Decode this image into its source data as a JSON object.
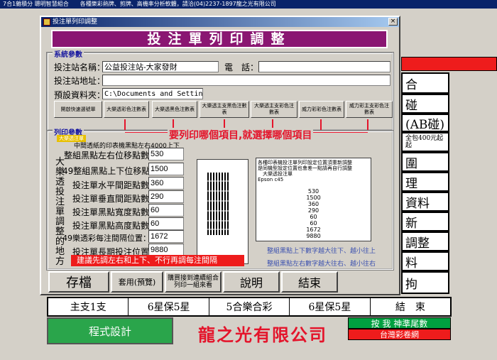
{
  "app": {
    "title": "7合1雜積分 聰明智慧組合　　各種樂彩熱牌、剪牌、高機率分析軟體，請洽(04)2237-1897龍之光有限公司"
  },
  "background": {
    "right_buttons": [
      "合",
      "碰",
      "(AB碰)",
      "全包400元起\n起",
      "圍",
      "理",
      "資料",
      "新",
      "調整",
      "料",
      "拘"
    ],
    "bottom_bar": [
      "主支1支",
      "6星保5星",
      "5合樂合彩",
      "6星保5星",
      "結　束"
    ],
    "program_button": "程式設計",
    "company": "龍之光有限公司",
    "green_box": "按 我 神準尾數",
    "red_box": "台灣彩卷網"
  },
  "dialog": {
    "title": "投注單列印調整",
    "close": "×",
    "banner": "投注單列印調整",
    "system_section": {
      "legend": "系統參數",
      "station_name_label": "投注站名稱：",
      "station_name_value": "公益投注站-大家發財",
      "phone_label": "電　話：",
      "phone_value": "",
      "station_address_label": "投注站地址：",
      "station_address_value": "",
      "default_folder_label": "預設資料夾：",
      "default_folder_value": "C:\\Documents and Settings\\",
      "buttons": [
        "開啟快速選號單",
        "大樂透彩色注數表",
        "大樂透黑色注數表",
        "大樂透主支黑色注數表",
        "大樂透主支彩色注數表",
        "威力彩彩色注數表",
        "威力彩主支彩色注數表"
      ]
    },
    "print_section": {
      "legend": "列印參數",
      "sublegend": "大樂透注單",
      "red_instruction": "要列印哪個項目,就選擇哪個項目",
      "note": "中間透紙的印表機黑點左右4000上下",
      "vertical_label": "大樂透投注單調整的地方",
      "fields": [
        {
          "label": "整組黑點左右位移點數",
          "value": "530"
        },
        {
          "label": "49整組黑點上下位移點數",
          "value": "1500"
        },
        {
          "label": "投注單水平間距點數：",
          "value": "360"
        },
        {
          "label": "投注單垂直間距點數：",
          "value": "290"
        },
        {
          "label": "投注單黑點寬度點數：",
          "value": "60"
        },
        {
          "label": "投注單黑點高度點數：",
          "value": "60"
        },
        {
          "label": "49樂透彩每注間隔位置：",
          "value": "1672"
        },
        {
          "label": "投注單長期投注位置：",
          "value": "9880"
        }
      ],
      "textbox_lines": [
        "各種印表機投注單列印設定位置須重新調整",
        "是同機型設定位置也會差一點請再自行調整",
        "　大樂透投注單",
        "Epson c45"
      ],
      "textbox_values": [
        "530",
        "1500",
        "360",
        "290",
        "60",
        "60",
        "1672",
        "9880"
      ],
      "hint1": "整組黑點上下數字越大往下、越小往上",
      "hint2": "整組黑點左右數字越大往右、越小往右",
      "warning": "建議先調左右和上下、不行再調每注間隔"
    },
    "actions": {
      "save": "存檔",
      "apply": "套用(預覽)",
      "print_one": "購買接到連續組合列印一組來看",
      "help": "說明",
      "exit": "結束"
    }
  }
}
